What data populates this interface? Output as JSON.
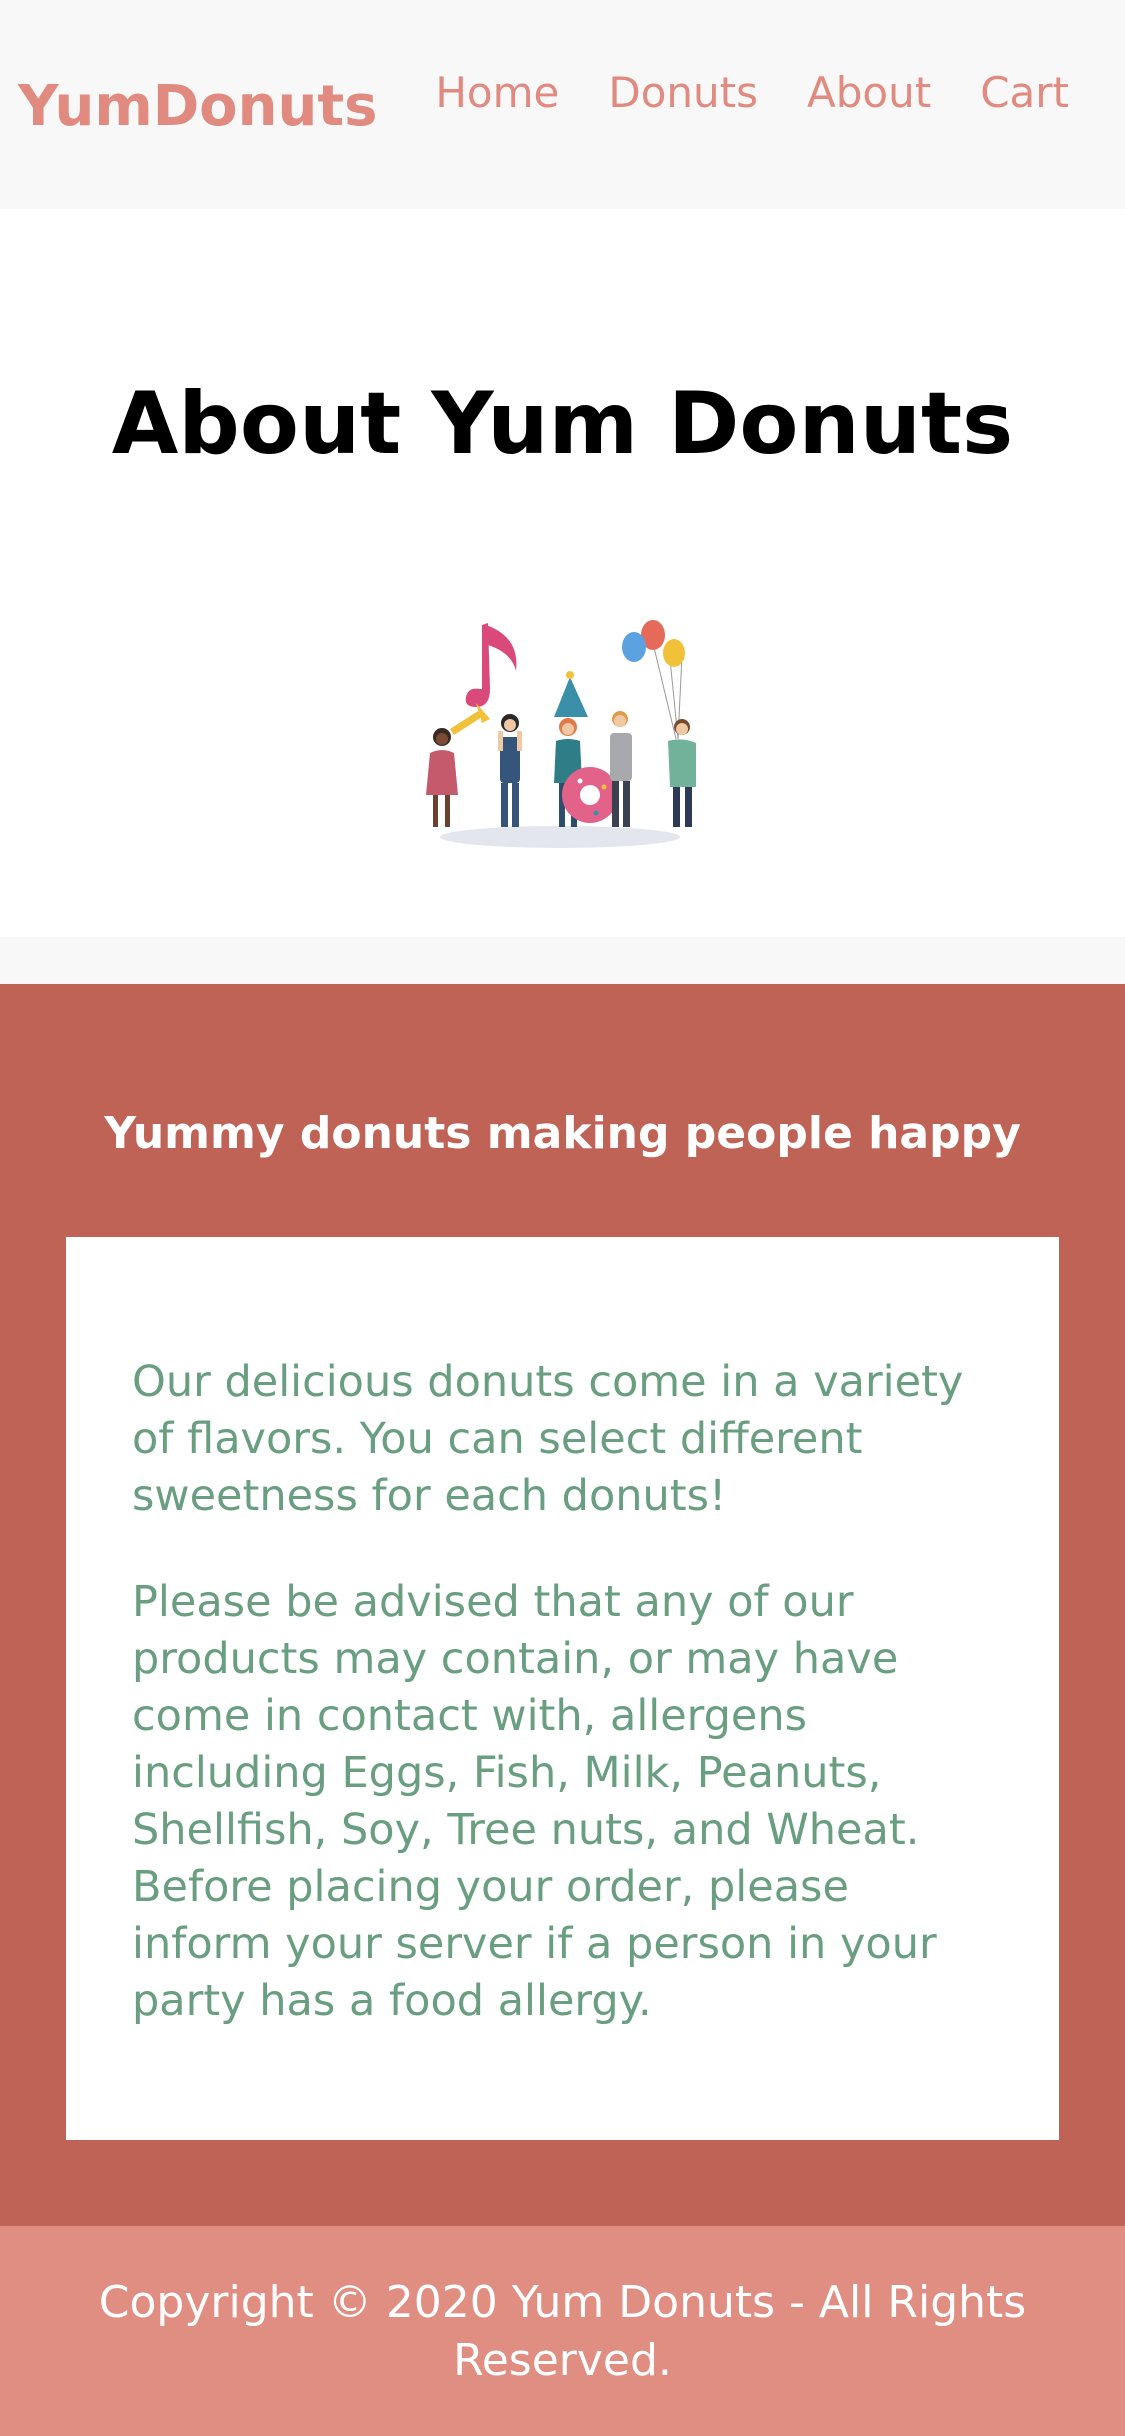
{
  "header": {
    "logo": "YumDonuts",
    "nav": [
      "Home",
      "Donuts",
      "About",
      "Cart"
    ]
  },
  "hero": {
    "title": "About Yum Donuts",
    "illustration": "people-celebrating-with-donut-balloons-music-illustration"
  },
  "story": {
    "tagline": "Yummy donuts making people happy",
    "paragraphs": [
      "Our delicious donuts come in a variety of flavors. You can select different sweetness for each donuts!",
      "Please be advised that any of our products may contain, or may have come in contact with, allergens including Eggs, Fish, Milk, Peanuts, Shellfish, Soy, Tree nuts, and Wheat. Before placing your order, please inform your server if a person in your party has a food allergy."
    ]
  },
  "footer": {
    "copyright": "Copyright © 2020 Yum Donuts - All Rights Reserved."
  },
  "colors": {
    "brand": "#e08a80",
    "section_bg": "#bf6357",
    "footer_bg": "#e08d82",
    "body_text": "#6a9e80"
  }
}
